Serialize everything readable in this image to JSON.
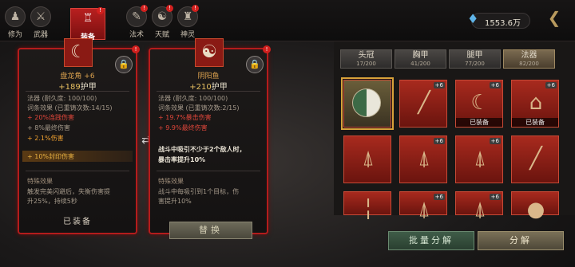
{
  "nav": [
    {
      "label": "修为",
      "icon": "person-icon",
      "glyph": "♟",
      "badge": ""
    },
    {
      "label": "武器",
      "icon": "sword-icon",
      "glyph": "⚔",
      "badge": ""
    },
    {
      "label": "装备",
      "icon": "armor-icon",
      "glyph": "👘",
      "badge": "!"
    },
    {
      "label": "法术",
      "icon": "scroll-icon",
      "glyph": "✎",
      "badge": "!"
    },
    {
      "label": "天赋",
      "icon": "talent-icon",
      "glyph": "☯",
      "badge": "!"
    },
    {
      "label": "神灵",
      "icon": "deity-icon",
      "glyph": "♜",
      "badge": "!"
    }
  ],
  "currency": {
    "value": "1553.6万",
    "icon": "crystal-icon"
  },
  "cards": [
    {
      "icon": "horn-icon",
      "name": "盘龙角 +6",
      "armor_plus": "+189",
      "armor_label": "护甲",
      "type_line": "法器   (耐久度: 100/100)",
      "affix_line": "词条效果  (已重铸次数:14/15)",
      "stat1": "+ 20%连践伤害",
      "stat2": "+ 8%最终伤害",
      "stat3": "+ 2.1%伤害",
      "stat4": "+ 10%封印伤害",
      "special_title": "特殊效果",
      "special_text1": "触发完美闪避后，失衡伤害提",
      "special_text2": "升25%，持续5秒",
      "status": "已装备"
    },
    {
      "icon": "yinyang-icon",
      "name": "阴阳鱼",
      "armor_plus": "+210",
      "armor_label": "护甲",
      "type_line": "法器   (耐久度: 100/100)",
      "affix_line": "词条效果  (已重铸次数:2/15)",
      "stat1": "+ 19.7%暴击伤害",
      "stat2": "+ 9.9%最终伤害",
      "combat_text1": "战斗中吸引不少于2个敌人时，",
      "combat_text2": "暴击率提升10%",
      "special_title": "特殊效果",
      "special_text1": "战斗中每吸引到1个目标，伤",
      "special_text2": "害提升10%"
    }
  ],
  "replace_button": "替换",
  "slot_tabs": [
    {
      "label": "头冠",
      "count": "17/200"
    },
    {
      "label": "胸甲",
      "count": "41/200"
    },
    {
      "label": "腿甲",
      "count": "77/200"
    },
    {
      "label": "法器",
      "count": "82/200"
    }
  ],
  "items": [
    {
      "icon": "yinyang-icon",
      "badge": "",
      "equipped": ""
    },
    {
      "icon": "flute-icon",
      "badge": "+6",
      "equipped": ""
    },
    {
      "icon": "horn-icon",
      "badge": "+6",
      "equipped": "已装备"
    },
    {
      "icon": "hanger-icon",
      "badge": "+6",
      "equipped": "已装备"
    },
    {
      "icon": "bell-icon",
      "badge": "",
      "equipped": ""
    },
    {
      "icon": "bell-icon",
      "badge": "+6",
      "equipped": ""
    },
    {
      "icon": "bell-icon",
      "badge": "+6",
      "equipped": ""
    },
    {
      "icon": "staff-icon",
      "badge": "",
      "equipped": ""
    },
    {
      "icon": "flute-icon",
      "badge": "",
      "equipped": ""
    },
    {
      "icon": "bell-icon",
      "badge": "+6",
      "equipped": ""
    },
    {
      "icon": "bell-icon",
      "badge": "+6",
      "equipped": ""
    },
    {
      "icon": "gourd-icon",
      "badge": "",
      "equipped": ""
    }
  ],
  "bottom": {
    "quick_dismantle": "批量分解",
    "dismantle": "分解"
  }
}
